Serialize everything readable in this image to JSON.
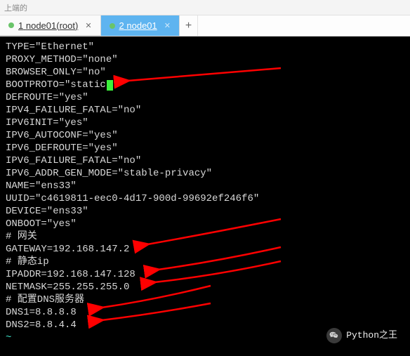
{
  "topstrip": "上端的",
  "tabs": [
    {
      "num": "1",
      "label": "node01(root)"
    },
    {
      "num": "2",
      "label": "node01"
    }
  ],
  "terminal": {
    "l0": "TYPE=\"Ethernet\"",
    "l1": "PROXY_METHOD=\"none\"",
    "l2": "BROWSER_ONLY=\"no\"",
    "l3a": "BOOTPROTO=\"",
    "l3b": "static",
    "l3c": "\"",
    "l4": "DEFROUTE=\"yes\"",
    "l5": "IPV4_FAILURE_FATAL=\"no\"",
    "l6": "IPV6INIT=\"yes\"",
    "l7": "IPV6_AUTOCONF=\"yes\"",
    "l8": "IPV6_DEFROUTE=\"yes\"",
    "l9": "IPV6_FAILURE_FATAL=\"no\"",
    "l10": "IPV6_ADDR_GEN_MODE=\"stable-privacy\"",
    "l11": "NAME=\"ens33\"",
    "l12": "UUID=\"c4619811-eec0-4d17-900d-99692ef246f6\"",
    "l13": "DEVICE=\"ens33\"",
    "l14": "ONBOOT=\"yes\"",
    "l15": "# 网关",
    "l16": "GATEWAY=192.168.147.2",
    "l17": "# 静态ip",
    "l18": "IPADDR=192.168.147.128",
    "l19": "NETMASK=255.255.255.0",
    "l20": "# 配置DNS服务器",
    "l21": "DNS1=8.8.8.8",
    "l22": "DNS2=8.8.4.4",
    "l23": "~"
  },
  "annotations": {
    "arrows_to": [
      "BOOTPROTO",
      "GATEWAY",
      "IPADDR",
      "NETMASK",
      "DNS1",
      "DNS2"
    ],
    "color": "#ff0000"
  },
  "watermark": {
    "text": "Python之王"
  },
  "chart_data": {
    "type": "table",
    "title": "Network interface config (vi)",
    "rows": [
      [
        "TYPE",
        "Ethernet"
      ],
      [
        "PROXY_METHOD",
        "none"
      ],
      [
        "BROWSER_ONLY",
        "no"
      ],
      [
        "BOOTPROTO",
        "static"
      ],
      [
        "DEFROUTE",
        "yes"
      ],
      [
        "IPV4_FAILURE_FATAL",
        "no"
      ],
      [
        "IPV6INIT",
        "yes"
      ],
      [
        "IPV6_AUTOCONF",
        "yes"
      ],
      [
        "IPV6_DEFROUTE",
        "yes"
      ],
      [
        "IPV6_FAILURE_FATAL",
        "no"
      ],
      [
        "IPV6_ADDR_GEN_MODE",
        "stable-privacy"
      ],
      [
        "NAME",
        "ens33"
      ],
      [
        "UUID",
        "c4619811-eec0-4d17-900d-99692ef246f6"
      ],
      [
        "DEVICE",
        "ens33"
      ],
      [
        "ONBOOT",
        "yes"
      ],
      [
        "GATEWAY",
        "192.168.147.2"
      ],
      [
        "IPADDR",
        "192.168.147.128"
      ],
      [
        "NETMASK",
        "255.255.255.0"
      ],
      [
        "DNS1",
        "8.8.8.8"
      ],
      [
        "DNS2",
        "8.8.4.4"
      ]
    ]
  }
}
